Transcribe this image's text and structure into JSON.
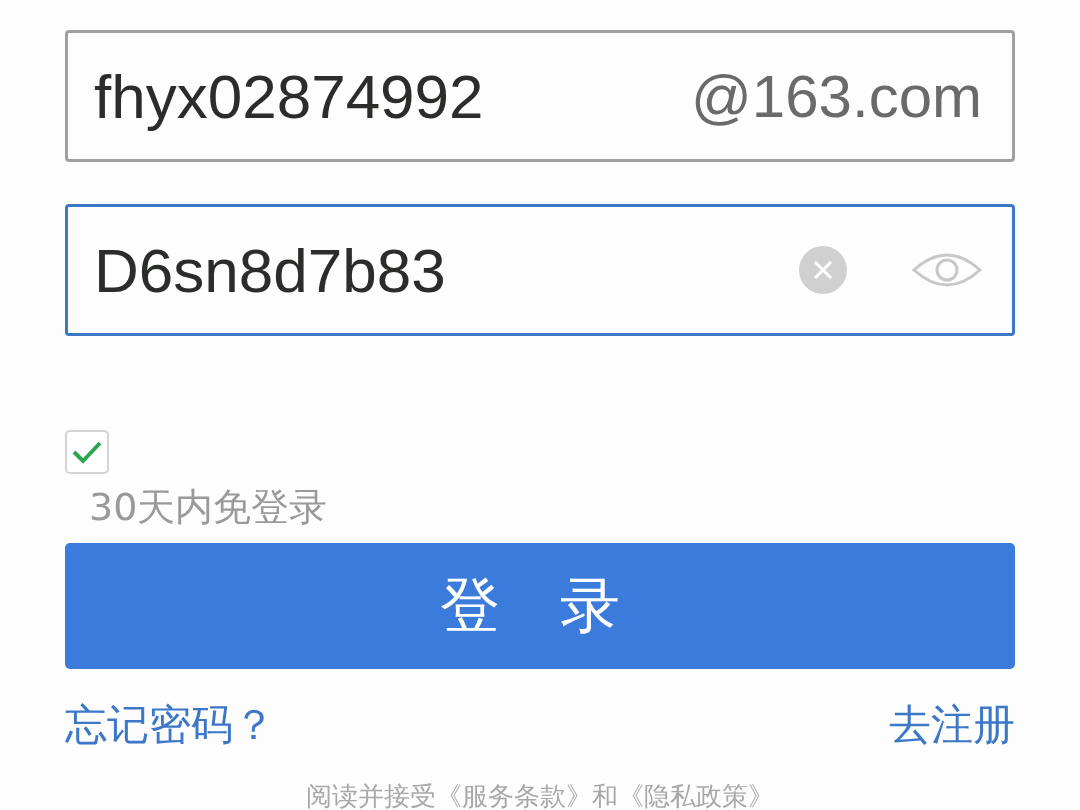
{
  "username": {
    "value": "fhyx02874992",
    "suffix": "@163.com",
    "focused": false
  },
  "password": {
    "value": "D6sn8d7b83",
    "focused": true
  },
  "remember": {
    "label": "30天内免登录",
    "checked": true
  },
  "login_button": "登 录",
  "links": [
    {
      "label": "忘记密码？"
    },
    {
      "label": "去注册"
    }
  ],
  "terms": "阅读并接受《服务条款》和《隐私政策》"
}
